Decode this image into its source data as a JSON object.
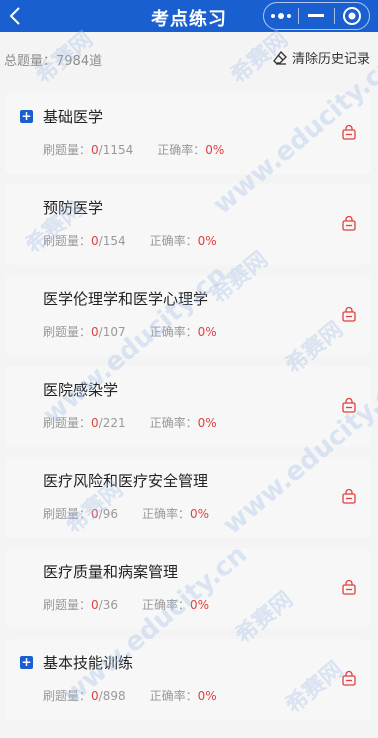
{
  "header": {
    "title": "考点练习"
  },
  "summary": {
    "total_label": "总题量：",
    "total_value": "7984道",
    "clear_label": "清除历史记录"
  },
  "items": [
    {
      "name": "基础医学",
      "has_plus": true,
      "count_label": "刷题量：",
      "done": "0",
      "total": "/1154",
      "rate_label": "正确率：",
      "rate": "0%"
    },
    {
      "name": "预防医学",
      "has_plus": false,
      "count_label": "刷题量：",
      "done": "0",
      "total": "/154",
      "rate_label": "正确率：",
      "rate": "0%"
    },
    {
      "name": "医学伦理学和医学心理学",
      "has_plus": false,
      "count_label": "刷题量：",
      "done": "0",
      "total": "/107",
      "rate_label": "正确率：",
      "rate": "0%"
    },
    {
      "name": "医院感染学",
      "has_plus": false,
      "count_label": "刷题量：",
      "done": "0",
      "total": "/221",
      "rate_label": "正确率：",
      "rate": "0%"
    },
    {
      "name": "医疗风险和医疗安全管理",
      "has_plus": false,
      "count_label": "刷题量：",
      "done": "0",
      "total": "/96",
      "rate_label": "正确率：",
      "rate": "0%"
    },
    {
      "name": "医疗质量和病案管理",
      "has_plus": false,
      "count_label": "刷题量：",
      "done": "0",
      "total": "/36",
      "rate_label": "正确率：",
      "rate": "0%"
    },
    {
      "name": "基本技能训练",
      "has_plus": true,
      "count_label": "刷题量：",
      "done": "0",
      "total": "/898",
      "rate_label": "正确率：",
      "rate": "0%"
    }
  ],
  "watermark": {
    "site": "www.educity.cn",
    "brand": "希赛网"
  },
  "colors": {
    "header": "#1a5fd0",
    "accent_red": "#e24040",
    "muted": "#999999"
  }
}
